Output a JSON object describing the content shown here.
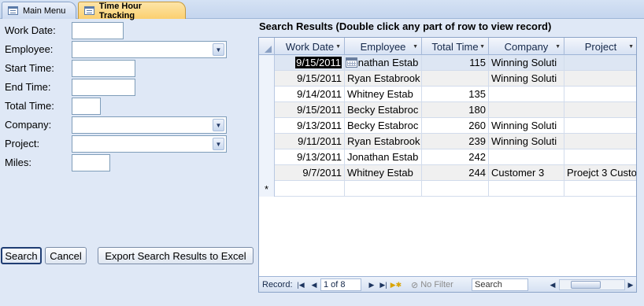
{
  "tabs": [
    {
      "label": "Main Menu",
      "active": false
    },
    {
      "label": "Time Hour Tracking",
      "active": true
    }
  ],
  "form": {
    "labels": {
      "work_date": "Work Date:",
      "employee": "Employee:",
      "start_time": "Start Time:",
      "end_time": "End Time:",
      "total_time": "Total Time:",
      "company": "Company:",
      "project": "Project:",
      "miles": "Miles:"
    },
    "values": {
      "work_date": "",
      "employee": "",
      "start_time": "",
      "end_time": "",
      "total_time": "",
      "company": "",
      "project": "",
      "miles": ""
    }
  },
  "buttons": {
    "search": "Search",
    "cancel": "Cancel",
    "export": "Export Search Results to Excel"
  },
  "results": {
    "title": "Search Results (Double click any part of row to view record)",
    "columns": [
      "Work Date",
      "Employee",
      "Total Time",
      "Company",
      "Project"
    ],
    "rows": [
      {
        "work_date": "9/15/2011",
        "employee": "Jonathan Estab",
        "total_time": "115",
        "company": "Winning Soluti",
        "project": ""
      },
      {
        "work_date": "9/15/2011",
        "employee": "Ryan Estabrook",
        "total_time": "",
        "company": "Winning Soluti",
        "project": ""
      },
      {
        "work_date": "9/14/2011",
        "employee": "Whitney Estab",
        "total_time": "135",
        "company": "",
        "project": ""
      },
      {
        "work_date": "9/15/2011",
        "employee": "Becky Estabroc",
        "total_time": "180",
        "company": "",
        "project": ""
      },
      {
        "work_date": "9/13/2011",
        "employee": "Becky Estabroc",
        "total_time": "260",
        "company": "Winning Soluti",
        "project": ""
      },
      {
        "work_date": "9/11/2011",
        "employee": "Ryan Estabrook",
        "total_time": "239",
        "company": "Winning Soluti",
        "project": ""
      },
      {
        "work_date": "9/13/2011",
        "employee": "Jonathan Estab",
        "total_time": "242",
        "company": "",
        "project": ""
      },
      {
        "work_date": "9/7/2011",
        "employee": "Whitney Estab",
        "total_time": "244",
        "company": "Customer 3",
        "project": "Proejct 3 Custo"
      }
    ],
    "new_row_marker": "*"
  },
  "navigation": {
    "record_label": "Record:",
    "record_position": "1 of 8",
    "no_filter": "No Filter",
    "search_placeholder": "Search"
  },
  "icons": {
    "first": "first-record-icon",
    "prev": "prev-record-icon",
    "next": "next-record-icon",
    "last": "last-record-icon",
    "new": "new-record-icon"
  },
  "colors": {
    "active_tab": "#fbcf6f",
    "form_background": "#dfe8f6",
    "grid_border": "#8ba3c7"
  }
}
